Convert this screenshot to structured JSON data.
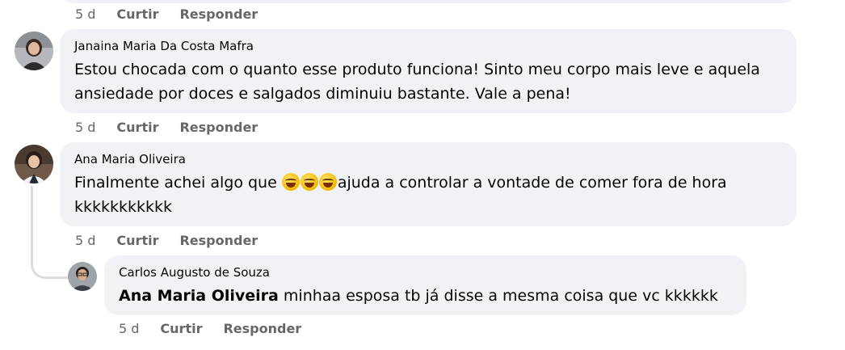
{
  "actions": {
    "time": "5 d",
    "like": "Curtir",
    "reply": "Responder"
  },
  "comments": [
    {
      "author": "Janaina Maria Da Costa Mafra",
      "text": "Estou chocada com o quanto esse produto funciona! Sinto meu corpo mais leve e aquela ansiedade por doces e salgados diminuiu bastante. Vale a pena!"
    },
    {
      "author": "Ana Maria Oliveira",
      "text_before": "Finalmente achei algo que ",
      "text_after": "ajuda a controlar a vontade de comer fora de hora kkkkkkkkkkk"
    },
    {
      "author": "Carlos Augusto de Souza",
      "mention": "Ana Maria Oliveira",
      "text": " minhaa esposa tb já disse a mesma coisa que vc kkkkkk"
    }
  ],
  "icons": {
    "emoji": "grinning-sweat-emoji"
  },
  "colors": {
    "bubble": "#f0f2f5",
    "meta": "#65676b",
    "text": "#050505"
  }
}
